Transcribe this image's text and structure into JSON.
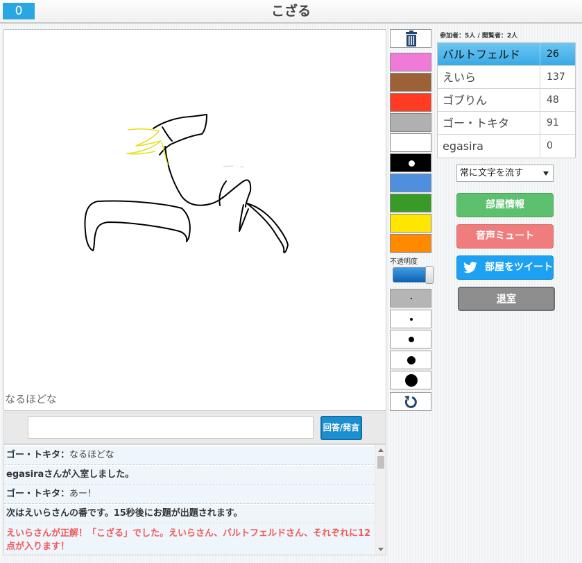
{
  "header": {
    "timer": "0",
    "title": "こざる"
  },
  "canvas": {
    "overlay_text": "なるほどな"
  },
  "answer": {
    "placeholder": "",
    "button_label": "回答/発言"
  },
  "chat": [
    {
      "name": "ゴー・トキタ：",
      "message": "なるほどな",
      "type": "user"
    },
    {
      "text": "egasiraさんが入室しました。",
      "type": "system"
    },
    {
      "name": "ゴー・トキタ：",
      "message": "あー！",
      "type": "user"
    },
    {
      "text": "次はえいらさんの番です。15秒後にお題が出題されます。",
      "type": "system"
    },
    {
      "text": "えいらさんが正解！「こざる」でした。えいらさん、バルトフェルドさん、それぞれに12点が入ります！",
      "type": "correct"
    }
  ],
  "tools": {
    "trash_icon": "trash-icon",
    "colors": [
      "#f07ad8",
      "#9c6136",
      "#ff3b23",
      "#b0b0b0",
      "#ffffff",
      "#000000",
      "#4f8fdd",
      "#3a9a28",
      "#ffe600",
      "#ff8a00"
    ],
    "selected_color_index": 5,
    "opacity_label": "不透明度",
    "opacity_value": 1.0,
    "brush_sizes": [
      2,
      4,
      8,
      12,
      18
    ],
    "selected_size_index": 0,
    "undo_icon": "undo-icon"
  },
  "room": {
    "participants_text": "参加者：5人 / 閲覧者：2人",
    "players": [
      {
        "name": "バルトフェルド",
        "score": "26",
        "active": true
      },
      {
        "name": "えいら",
        "score": "137",
        "active": false
      },
      {
        "name": "ゴブりん",
        "score": "48",
        "active": false
      },
      {
        "name": "ゴー・トキタ",
        "score": "91",
        "active": false
      },
      {
        "name": "egasira",
        "score": "0",
        "active": false
      }
    ],
    "mode_select": "常に文字を流す",
    "buttons": {
      "info": "部屋情報",
      "mute": "音声ミュート",
      "tweet": "部屋をツイート",
      "leave": "退室"
    },
    "tweet_icon": "twitter-bird-icon"
  }
}
